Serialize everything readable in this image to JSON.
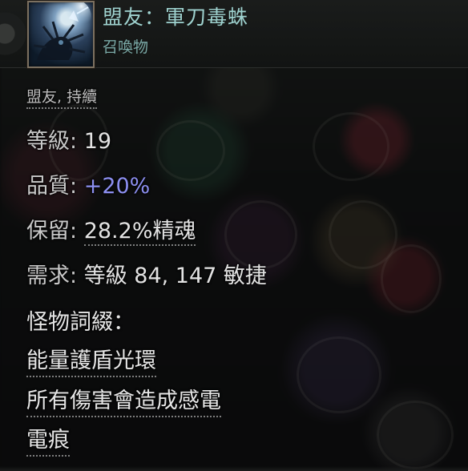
{
  "header": {
    "title": "盟友：軍刀毒蛛",
    "subtitle": "召喚物",
    "icon": "spider-minion-portrait-icon"
  },
  "tags": "盟友, 持續",
  "stats": {
    "level": {
      "label": "等級:",
      "value": "19"
    },
    "quality": {
      "label": "品質:",
      "value": "+20%"
    },
    "reservation": {
      "label": "保留:",
      "value": "28.2%精魂"
    },
    "requirements": {
      "label": "需求:",
      "value": "等級 84, 147 敏捷"
    }
  },
  "mods": {
    "heading": "怪物詞綴：",
    "items": [
      "能量護盾光環",
      "所有傷害會造成感電",
      "電痕"
    ]
  },
  "colors": {
    "title": "#9fd3d0",
    "subtitle": "#7aa9a6",
    "augmented_value": "#8c8ff0",
    "text": "#e3e3e3"
  }
}
